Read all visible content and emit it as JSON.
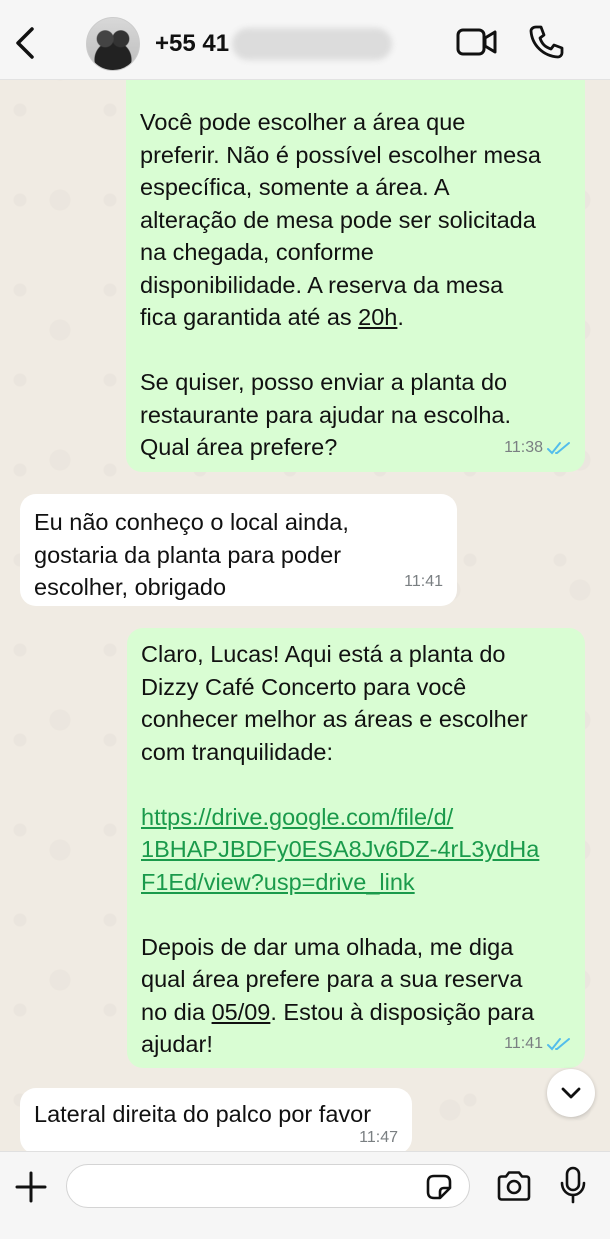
{
  "header": {
    "contact_name": "+55 41",
    "back_icon": "chevron-left-icon",
    "video_icon": "video-camera-icon",
    "call_icon": "phone-icon"
  },
  "messages": [
    {
      "direction": "outgoing",
      "parts": {
        "a": "Você pode escolher a área que\npreferir. Não é possível escolher mesa\nespecífica, somente a área. A\nalteração de mesa pode ser solicitada\nna chegada, conforme\ndisponibilidade. A reserva da mesa\nfica garantida até as ",
        "u": "20h",
        "b": ".\n\nSe quiser, posso enviar a planta do\nrestaurante para ajudar na escolha.\nQual área prefere?"
      },
      "time": "11:38",
      "status": "read"
    },
    {
      "direction": "incoming",
      "text": "Eu não conheço o local ainda,\ngostaria da planta para poder\nescolher, obrigado",
      "time": "11:41"
    },
    {
      "direction": "outgoing",
      "parts": {
        "a": "Claro, Lucas! Aqui está a planta do\nDizzy Café Concerto para você\nconhecer melhor as áreas e escolher\ncom tranquilidade:\n\n",
        "link": "https://drive.google.com/file/d/\n1BHAPJBDFy0ESA8Jv6DZ-4rL3ydHa\nF1Ed/view?usp=drive_link",
        "b": "\n\nDepois de dar uma olhada, me diga\nqual área prefere para a sua reserva\nno dia ",
        "u": "05/09",
        "c": ". Estou à disposição para\najudar!"
      },
      "time": "11:41",
      "status": "read"
    },
    {
      "direction": "incoming",
      "text": "Lateral direita do palco por favor",
      "time": "11:47"
    }
  ],
  "input": {
    "placeholder": "",
    "value": ""
  },
  "colors": {
    "outgoing_bubble": "#d9fdd3",
    "incoming_bubble": "#ffffff",
    "read_ticks": "#53bdeb",
    "link": "#1a9a4b"
  }
}
